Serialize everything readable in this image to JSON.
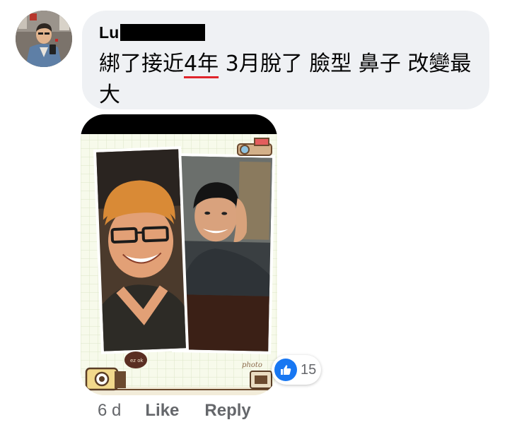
{
  "comment": {
    "author": {
      "name_visible": "Lu",
      "avatar_icon": "profile-avatar"
    },
    "text_line_1_before": "綁了接近",
    "text_underlined": "4年",
    "text_line_1_after": " 3月脫了 臉型 鼻子 改變最大",
    "colors": {
      "bubble": "#eff1f4",
      "underline": "#e0242b"
    }
  },
  "attachment": {
    "type": "photo",
    "caption_text": "photo"
  },
  "reactions": {
    "icon": "thumbs-up-icon",
    "count": "15",
    "color": "#1877f2"
  },
  "actions": {
    "timestamp": "6 d",
    "like_label": "Like",
    "reply_label": "Reply"
  }
}
